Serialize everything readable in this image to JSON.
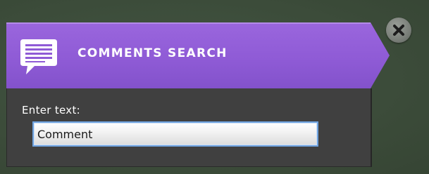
{
  "dialog": {
    "title": "COMMENTS SEARCH",
    "icon": "comment-icon",
    "accent_color": "#8f5bd6",
    "body_color": "#404040",
    "input": {
      "label": "Enter text:",
      "value": "Comment",
      "placeholder": ""
    },
    "close": {
      "icon": "close-icon"
    }
  }
}
